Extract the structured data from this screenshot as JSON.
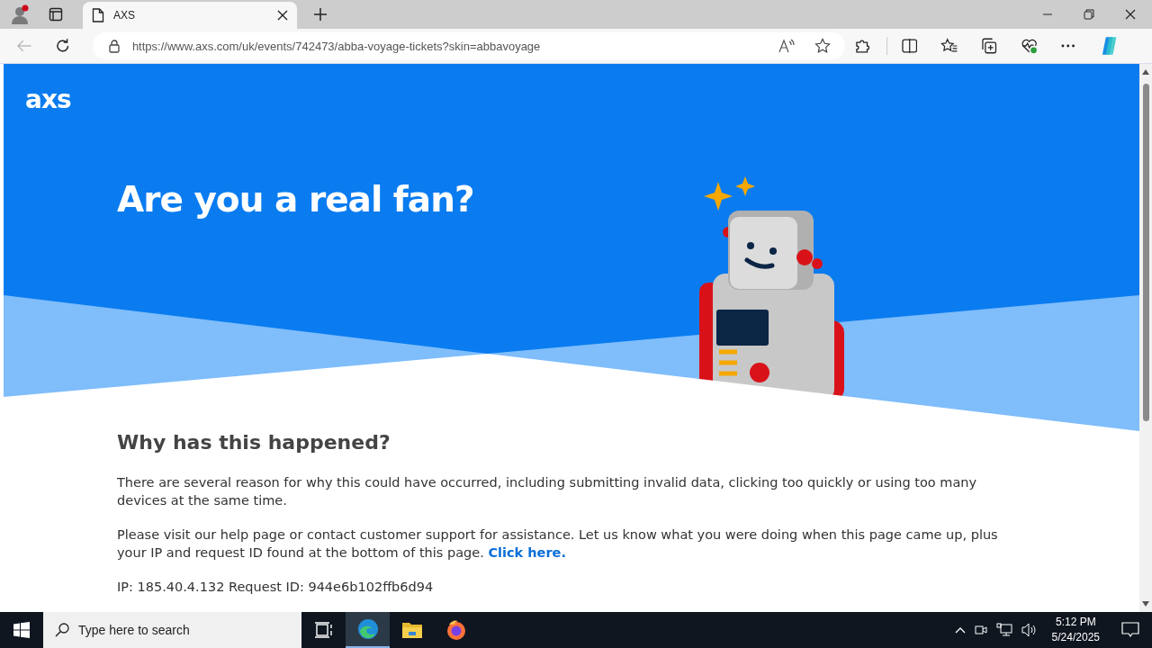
{
  "browser": {
    "tabs": [
      {
        "title": "AXS",
        "selected": true
      }
    ],
    "url": "https://www.axs.com/uk/events/742473/abba-voyage-tickets?skin=abbavoyage"
  },
  "page": {
    "logo": "axs",
    "title": "Are you a real fan?",
    "heading": "Why has this happened?",
    "paragraph_1": "There are several reason for why this could have occurred, including submitting invalid data, clicking too quickly or using too many devices at the same time.",
    "paragraph_2": "Please visit our help page or contact customer support for assistance. Let us know what you were doing when this page came up, plus your IP and request ID found at the bottom of this page.",
    "link": "Click here.",
    "ip_line": "IP: 185.40.4.132 Request ID: 944e6b102ffb6d94"
  },
  "taskbar": {
    "search_placeholder": "Type here to search",
    "apps": [
      {
        "kind": "taskview",
        "selected": false
      },
      {
        "kind": "edge",
        "selected": true
      },
      {
        "kind": "explorer",
        "selected": false
      },
      {
        "kind": "firefox",
        "selected": false
      }
    ],
    "time": "5:12 PM",
    "date": "5/24/2025"
  }
}
